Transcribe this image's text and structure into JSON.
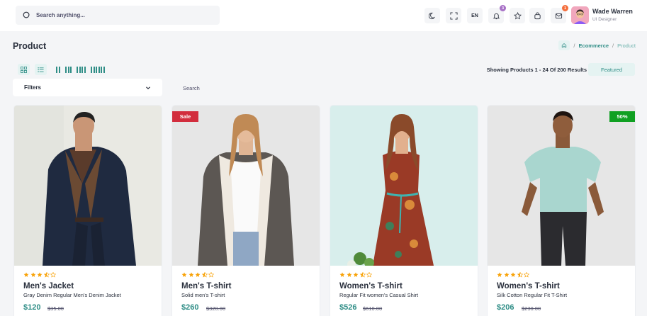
{
  "header": {
    "search_placeholder": "Search anything...",
    "language": "EN",
    "notifications_count": "3",
    "cart_count": "1",
    "user": {
      "name": "Wade Warren",
      "role": "UI Designer"
    }
  },
  "page": {
    "title": "Product",
    "breadcrumb": {
      "section": "Ecommerce",
      "current": "Product"
    }
  },
  "toolbar": {
    "showing_text": "Showing Products 1 - 24 Of 200 Results",
    "sort_label": "Featured",
    "filters_label": "Filters",
    "search_placeholder": "Search"
  },
  "products": [
    {
      "name": "Men's Jacket",
      "description": "Gray Denim Regular Men's Denim Jacket",
      "price": "$120",
      "old_price": "$35.00",
      "rating": 3.5,
      "tag": ""
    },
    {
      "name": "Men's T-shirt",
      "description": "Solid men's T-shirt",
      "price": "$260",
      "old_price": "$320.00",
      "rating": 3.5,
      "tag": "Sale"
    },
    {
      "name": "Women's T-shirt",
      "description": "Regular Fit women's Casual Shirt",
      "price": "$526",
      "old_price": "$610.00",
      "rating": 3.5,
      "tag": ""
    },
    {
      "name": "Women's T-shirt",
      "description": "Silk Cotton Regular Fit T-Shirt",
      "price": "$206",
      "old_price": "$230.00",
      "rating": 3.5,
      "tag": "50%"
    }
  ],
  "colors": {
    "accent": "#308e87",
    "sale_tag": "#d22d3d",
    "discount_tag": "#10a022",
    "star": "#f8a30a",
    "notify_badge": "#a770c6",
    "cart_badge": "#f46e3c"
  }
}
